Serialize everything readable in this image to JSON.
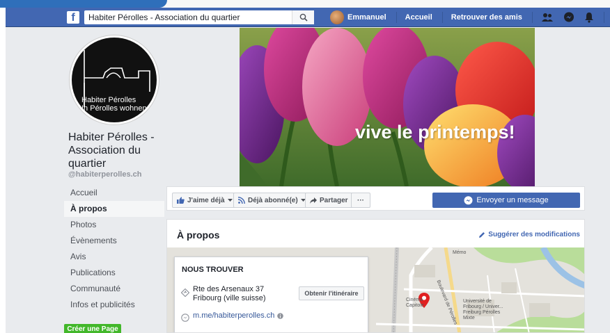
{
  "topbar": {
    "search_value": "Habiter Pérolles - Association du quartier",
    "user_name": "Emmanuel",
    "home_label": "Accueil",
    "find_friends_label": "Retrouver des amis",
    "brand_color": "#4267b2"
  },
  "profile": {
    "logo_line1": "Habiter Pérolles",
    "logo_line2": "In Pérolles wohnen",
    "page_name": "Habiter Pérolles - Association du quartier",
    "handle": "@habiterperolles.ch"
  },
  "leftnav": {
    "items": [
      {
        "label": "Accueil"
      },
      {
        "label": "À propos"
      },
      {
        "label": "Photos"
      },
      {
        "label": "Évènements"
      },
      {
        "label": "Avis"
      },
      {
        "label": "Publications"
      },
      {
        "label": "Communauté"
      },
      {
        "label": "Infos et publicités"
      }
    ],
    "active_index": 1,
    "create_page_label": "Créer une Page"
  },
  "cover": {
    "caption": "vive le printemps!"
  },
  "actions": {
    "like_label": "J'aime déjà",
    "follow_label": "Déjà abonné(e)",
    "share_label": "Partager",
    "more_label": "···",
    "message_label": "Envoyer un message"
  },
  "about": {
    "title": "À propos",
    "suggest_label": "Suggérer des modifications",
    "find_us_title": "NOUS TROUVER",
    "address_line1": "Rte des Arsenaux 37",
    "address_line2": "Fribourg (ville suisse)",
    "directions_label": "Obtenir l'itinéraire",
    "messenger_link": "m.me/habiterperolles.ch",
    "map_labels": [
      "Boulevard de Pérolles",
      "Université de Fribourg / Univer... Freiburg Pérolles Mixte",
      "Cinéma Capitole",
      "Mémo"
    ]
  }
}
